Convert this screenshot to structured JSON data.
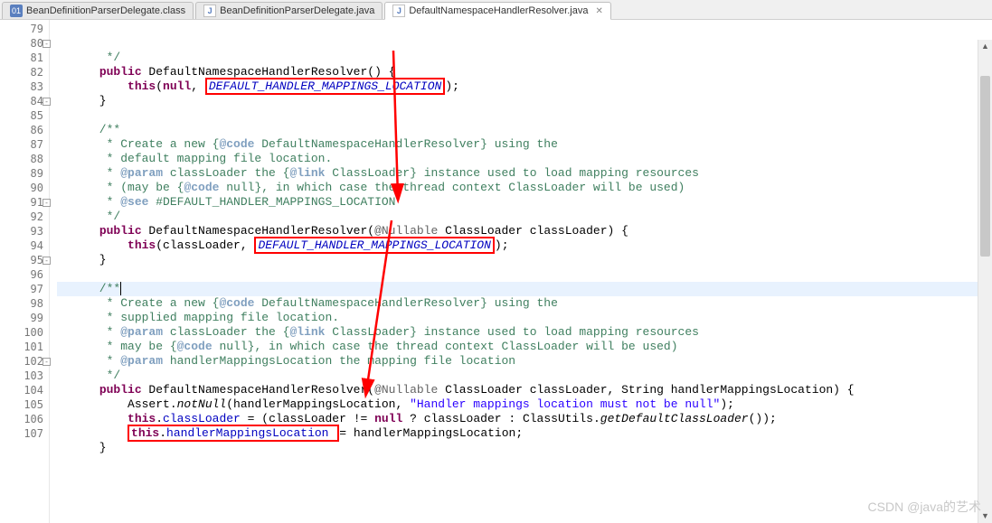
{
  "tabs": [
    {
      "label": "BeanDefinitionParserDelegate.class",
      "icon": "01",
      "active": false
    },
    {
      "label": "BeanDefinitionParserDelegate.java",
      "icon": "J",
      "active": false
    },
    {
      "label": "DefaultNamespaceHandlerResolver.java",
      "icon": "J",
      "active": true
    }
  ],
  "watermark": "CSDN @java的艺术",
  "lines": [
    {
      "n": "79",
      "fold": "",
      "t": "       */",
      "cls": "com"
    },
    {
      "n": "80",
      "fold": "⊟",
      "html": "      <span class='kw'>public</span> DefaultNamespaceHandlerResolver() {"
    },
    {
      "n": "81",
      "html": "          <span class='kw'>this</span>(<span class='kw'>null</span>, <span class='box'><span class='sfld'>DEFAULT_HANDLER_MAPPINGS_LOCATION</span></span>);"
    },
    {
      "n": "82",
      "t": "      }"
    },
    {
      "n": "83",
      "t": ""
    },
    {
      "n": "84",
      "fold": "⊟",
      "t": "      /**",
      "cls": "com"
    },
    {
      "n": "85",
      "html": "<span class='com'>       * Create a new {</span><span class='doctag'>@code</span><span class='com'> DefaultNamespaceHandlerResolver} using the</span>"
    },
    {
      "n": "86",
      "t": "       * default mapping file location.",
      "cls": "com"
    },
    {
      "n": "87",
      "html": "<span class='com'>       * </span><span class='doctag'>@param</span><span class='com'> classLoader the {</span><span class='doctag'>@link</span><span class='com'> ClassLoader} instance used to load mapping resources</span>"
    },
    {
      "n": "88",
      "html": "<span class='com'>       * (may be {</span><span class='doctag'>@code</span><span class='com'> null}, in which case the thread context ClassLoader will be used)</span>"
    },
    {
      "n": "89",
      "html": "<span class='com'>       * </span><span class='doctag'>@see</span><span class='com'> #DEFAULT_HANDLER_MAPPINGS_LOCATION</span>"
    },
    {
      "n": "90",
      "t": "       */",
      "cls": "com"
    },
    {
      "n": "91",
      "fold": "⊟",
      "html": "      <span class='kw'>public</span> DefaultNamespaceHandlerResolver(<span class='ann'>@Nullable</span> ClassLoader classLoader) {"
    },
    {
      "n": "92",
      "html": "          <span class='kw'>this</span>(classLoader, <span class='box'><span class='sfld'>DEFAULT_HANDLER_MAPPINGS_LOCATION</span></span>);"
    },
    {
      "n": "93",
      "t": "      }"
    },
    {
      "n": "94",
      "t": ""
    },
    {
      "n": "95",
      "fold": "⊟",
      "hl": true,
      "html": "<span class='com'>      /**</span><span style='border-left:1px solid #000;height:15px;display:inline-block;vertical-align:middle'></span>"
    },
    {
      "n": "96",
      "html": "<span class='com'>       * Create a new {</span><span class='doctag'>@code</span><span class='com'> DefaultNamespaceHandlerResolver} using the</span>"
    },
    {
      "n": "97",
      "t": "       * supplied mapping file location.",
      "cls": "com"
    },
    {
      "n": "98",
      "html": "<span class='com'>       * </span><span class='doctag'>@param</span><span class='com'> classLoader the {</span><span class='doctag'>@link</span><span class='com'> ClassLoader} instance used to load mapping resources</span>"
    },
    {
      "n": "99",
      "html": "<span class='com'>       * may be {</span><span class='doctag'>@code</span><span class='com'> null}, in which case the thread context ClassLoader will be used)</span>"
    },
    {
      "n": "100",
      "html": "<span class='com'>       * </span><span class='doctag'>@param</span><span class='com'> handlerMappingsLocation the mapping file location</span>"
    },
    {
      "n": "101",
      "t": "       */",
      "cls": "com"
    },
    {
      "n": "102",
      "fold": "⊟",
      "html": "      <span class='kw'>public</span> DefaultNamespaceHandlerResolver(<span class='ann'>@Nullable</span> ClassLoader classLoader, String handlerMappingsLocation) {"
    },
    {
      "n": "103",
      "html": "          Assert.<span class='stat'>notNull</span>(handlerMappingsLocation, <span class='str'>\"Handler mappings location must not be null\"</span>);"
    },
    {
      "n": "104",
      "html": "          <span class='kw'>this</span>.<span class='fld'>classLoader</span> = (classLoader != <span class='kw'>null</span> ? classLoader : ClassUtils.<span class='stat'>getDefaultClassLoader</span>());"
    },
    {
      "n": "105",
      "html": "          <span class='box'><span class='kw'>this</span>.<span class='fld'>handlerMappingsLocation</span> </span>= handlerMappingsLocation;"
    },
    {
      "n": "106",
      "t": "      }"
    },
    {
      "n": "107",
      "t": ""
    }
  ]
}
